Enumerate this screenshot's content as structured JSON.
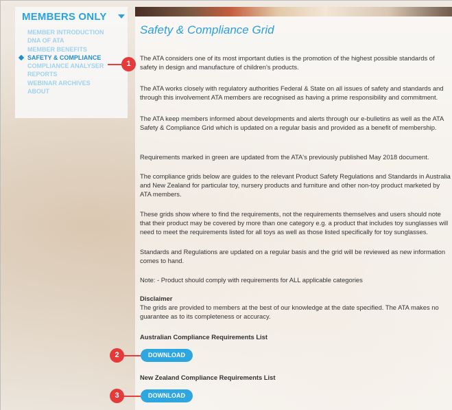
{
  "sidebar": {
    "title": "MEMBERS ONLY",
    "items": [
      {
        "label": "MEMBER INTRODUCTION"
      },
      {
        "label": "DNA OF ATA"
      },
      {
        "label": "MEMBER BENEFITS"
      },
      {
        "label": "SAFETY & COMPLIANCE",
        "active": true
      },
      {
        "label": "COMPLIANCE ANALYSER"
      },
      {
        "label": "REPORTS"
      },
      {
        "label": "WEBINAR ARCHIVES"
      },
      {
        "label": "ABOUT"
      }
    ]
  },
  "main": {
    "title": "Safety & Compliance Grid",
    "paragraphs": [
      "The ATA considers one of its most important duties is the promotion of the highest possible standards of safety in design and manufacture of children's products.",
      "The ATA works closely with regulatory authorities Federal & State on all issues of safety and standards and through this involvement ATA members are recognised as having a prime responsibility and commitment.",
      "The ATA keep members informed about developments and alerts through our e-bulletins as well as the ATA Safety & Compliance Grid which is updated on a regular basis and provided as a benefit of membership.",
      "Requirements marked in green are updated from the ATA's previously published May 2018 document.",
      "The compliance grids below are guides to the relevant Product Safety Regulations and Standards in Australia and New Zealand for particular toy, nursery products and furniture and other non-toy product marketed by ATA members.",
      "These grids show where to find the requirements, not the requirements themselves and users should note that their product may be covered by more than one category e.g. a product that includes toy sunglasses will need to meet the requirements listed for all toys as well as those listed specifically for toy sunglasses.",
      "Standards and Regulations are updated on a regular basis and the grid will be reviewed as new information comes to hand.",
      "Note: - Product should comply with requirements for ALL applicable categories"
    ],
    "disclaimer_heading": "Disclaimer",
    "disclaimer_text": "The grids are provided to members at the best of our knowledge at the date specified. The ATA makes no guarantee as to its completeness or accuracy.",
    "au_heading": "Australian Compliance Requirements List",
    "nz_heading": "New Zealand Compliance Requirements List",
    "download_label": "DOWNLOAD"
  },
  "callouts": [
    "1",
    "2",
    "3"
  ],
  "colors": {
    "accent": "#29a3df",
    "callout": "#e53a3a",
    "button": "#2ea6e0"
  }
}
